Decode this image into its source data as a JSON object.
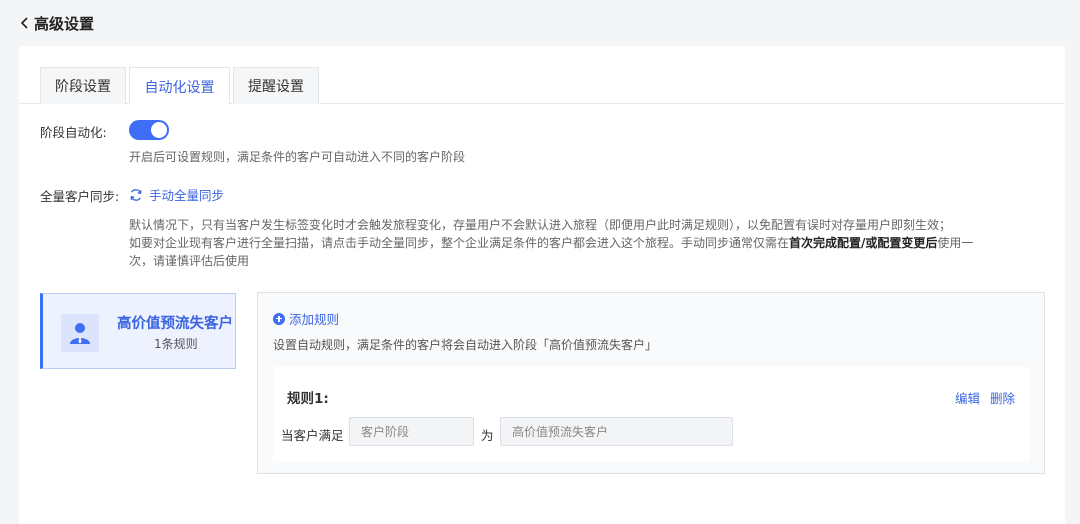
{
  "header": {
    "back_icon": "chevron-left-icon",
    "title": "高级设置"
  },
  "tabs": [
    {
      "label": "阶段设置",
      "active": false
    },
    {
      "label": "自动化设置",
      "active": true
    },
    {
      "label": "提醒设置",
      "active": false
    }
  ],
  "stage_automation": {
    "label": "阶段自动化:",
    "enabled": true,
    "hint": "开启后可设置规则，满足条件的客户可自动进入不同的客户阶段"
  },
  "full_sync": {
    "label": "全量客户同步:",
    "button_icon": "refresh-icon",
    "button_label": "手动全量同步",
    "desc_line1": "默认情况下，只有当客户发生标签变化时才会触发旅程变化，存量用户不会默认进入旅程（即便用户此时满足规则），以免配置有误时对存量用户即刻生效；",
    "desc_line2_prefix": "如要对企业现有客户进行全量扫描，请点击手动全量同步，整个企业满足条件的客户都会进入这个旅程。手动同步通常仅需在",
    "desc_line2_bold": "首次完成配置/或配置变更后",
    "desc_line2_suffix": "使用一",
    "desc_line3": "次，请谨慎评估后使用"
  },
  "stage": {
    "icon": "user-icon",
    "name": "高价值预流失客户",
    "count": "1条规则"
  },
  "rules_panel": {
    "add_icon": "plus-circle-icon",
    "add_label": "添加规则",
    "hint": "设置自动规则，满足条件的客户将会自动进入阶段「高价值预流失客户」",
    "rules": [
      {
        "title": "规则1:",
        "edit_label": "编辑",
        "delete_label": "删除",
        "condition_label": "当客户满足",
        "field": "客户阶段",
        "operator": "为",
        "value": "高价值预流失客户"
      }
    ]
  },
  "colors": {
    "accent": "#3d6ef5",
    "link": "#3a64e0",
    "background": "#f4f5f7"
  }
}
